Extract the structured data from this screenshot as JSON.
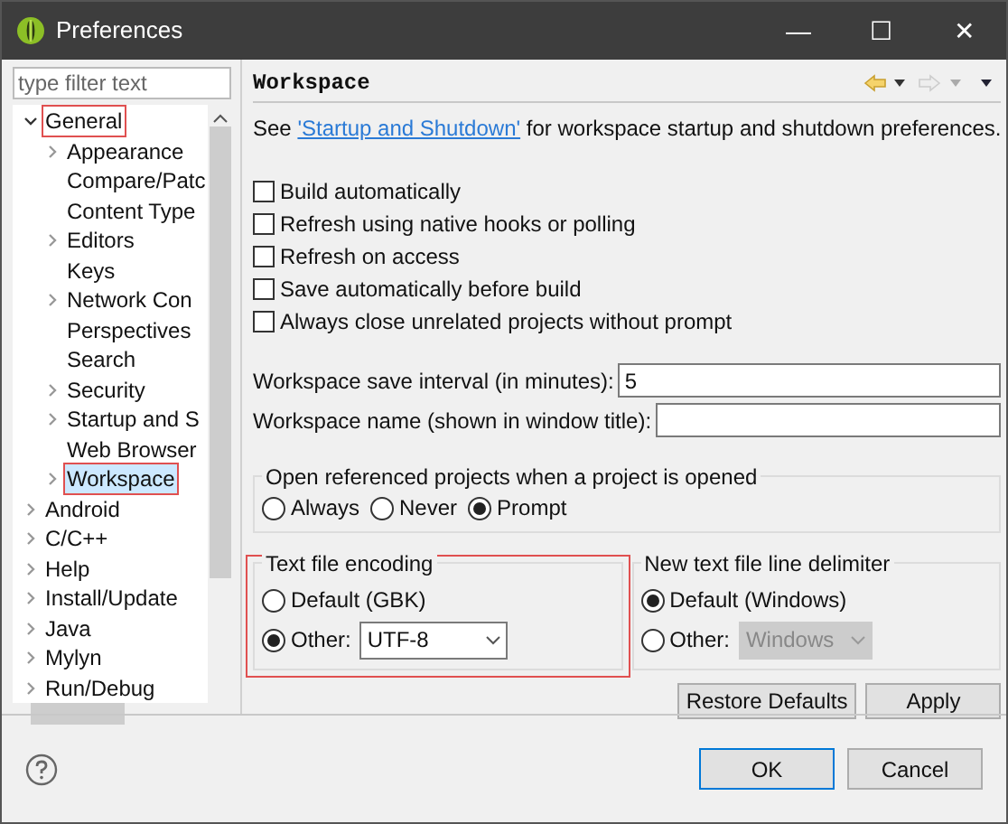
{
  "window": {
    "title": "Preferences",
    "buttons": [
      "—",
      "☐",
      "✕"
    ]
  },
  "filter": {
    "placeholder": "type filter text"
  },
  "tree": [
    {
      "label": "General",
      "kind": "node",
      "expanded": true,
      "selected": false,
      "annotated": true,
      "children": [
        {
          "label": "Appearance",
          "kind": "node",
          "expanded": false,
          "selected": false,
          "annotated": false
        },
        {
          "label": "Compare/Patc",
          "kind": "leaf",
          "selected": false,
          "annotated": false
        },
        {
          "label": "Content Type",
          "kind": "leaf",
          "selected": false,
          "annotated": false
        },
        {
          "label": "Editors",
          "kind": "node",
          "expanded": false,
          "selected": false,
          "annotated": false
        },
        {
          "label": "Keys",
          "kind": "leaf",
          "selected": false,
          "annotated": false
        },
        {
          "label": "Network Con",
          "kind": "node",
          "expanded": false,
          "selected": false,
          "annotated": false
        },
        {
          "label": "Perspectives",
          "kind": "leaf",
          "selected": false,
          "annotated": false
        },
        {
          "label": "Search",
          "kind": "leaf",
          "selected": false,
          "annotated": false
        },
        {
          "label": "Security",
          "kind": "node",
          "expanded": false,
          "selected": false,
          "annotated": false
        },
        {
          "label": "Startup and S",
          "kind": "node",
          "expanded": false,
          "selected": false,
          "annotated": false
        },
        {
          "label": "Web Browser",
          "kind": "leaf",
          "selected": false,
          "annotated": false
        },
        {
          "label": "Workspace",
          "kind": "node",
          "expanded": false,
          "selected": true,
          "annotated": true
        }
      ]
    },
    {
      "label": "Android",
      "kind": "node",
      "expanded": false,
      "selected": false,
      "annotated": false
    },
    {
      "label": "C/C++",
      "kind": "node",
      "expanded": false,
      "selected": false,
      "annotated": false
    },
    {
      "label": "Help",
      "kind": "node",
      "expanded": false,
      "selected": false,
      "annotated": false
    },
    {
      "label": "Install/Update",
      "kind": "node",
      "expanded": false,
      "selected": false,
      "annotated": false
    },
    {
      "label": "Java",
      "kind": "node",
      "expanded": false,
      "selected": false,
      "annotated": false
    },
    {
      "label": "Mylyn",
      "kind": "node",
      "expanded": false,
      "selected": false,
      "annotated": false
    },
    {
      "label": "Run/Debug",
      "kind": "node",
      "expanded": false,
      "selected": false,
      "annotated": false
    }
  ],
  "page": {
    "title": "Workspace",
    "intro_before": "See",
    "link": "'Startup and Shutdown'",
    "intro_after": "for workspace startup and shutdown preferences."
  },
  "checkboxes": [
    {
      "label": "Build automatically",
      "checked": false
    },
    {
      "label": "Refresh using native hooks or polling",
      "checked": false
    },
    {
      "label": "Refresh on access",
      "checked": false
    },
    {
      "label": "Save automatically before build",
      "checked": false
    },
    {
      "label": "Always close unrelated projects without prompt",
      "checked": false
    }
  ],
  "fields": [
    {
      "label": "Workspace save interval (in minutes):",
      "value": "5"
    },
    {
      "label": "Workspace name (shown in window title):"
    }
  ],
  "open_projects": {
    "title": "Open referenced projects when a project is opened",
    "options": [
      {
        "label": "Always",
        "selected": false
      },
      {
        "label": "Never",
        "selected": false
      },
      {
        "label": "Prompt",
        "selected": true
      }
    ]
  },
  "encoding": {
    "title": "Text file encoding",
    "annotated": true,
    "default_label": "Default (GBK)",
    "default_selected": false,
    "other_label": "Other:",
    "other_selected": true,
    "other_value": "UTF-8",
    "other_disabled": false
  },
  "delimiter": {
    "title": "New text file line delimiter",
    "default_label": "Default (Windows)",
    "default_selected": true,
    "other_label": "Other:",
    "other_selected": false,
    "other_value": "Windows",
    "other_disabled": true
  },
  "page_buttons": [
    "Restore Defaults",
    "Apply"
  ],
  "dialog_buttons": [
    {
      "label": "OK",
      "default": true
    },
    {
      "label": "Cancel",
      "default": false
    }
  ]
}
